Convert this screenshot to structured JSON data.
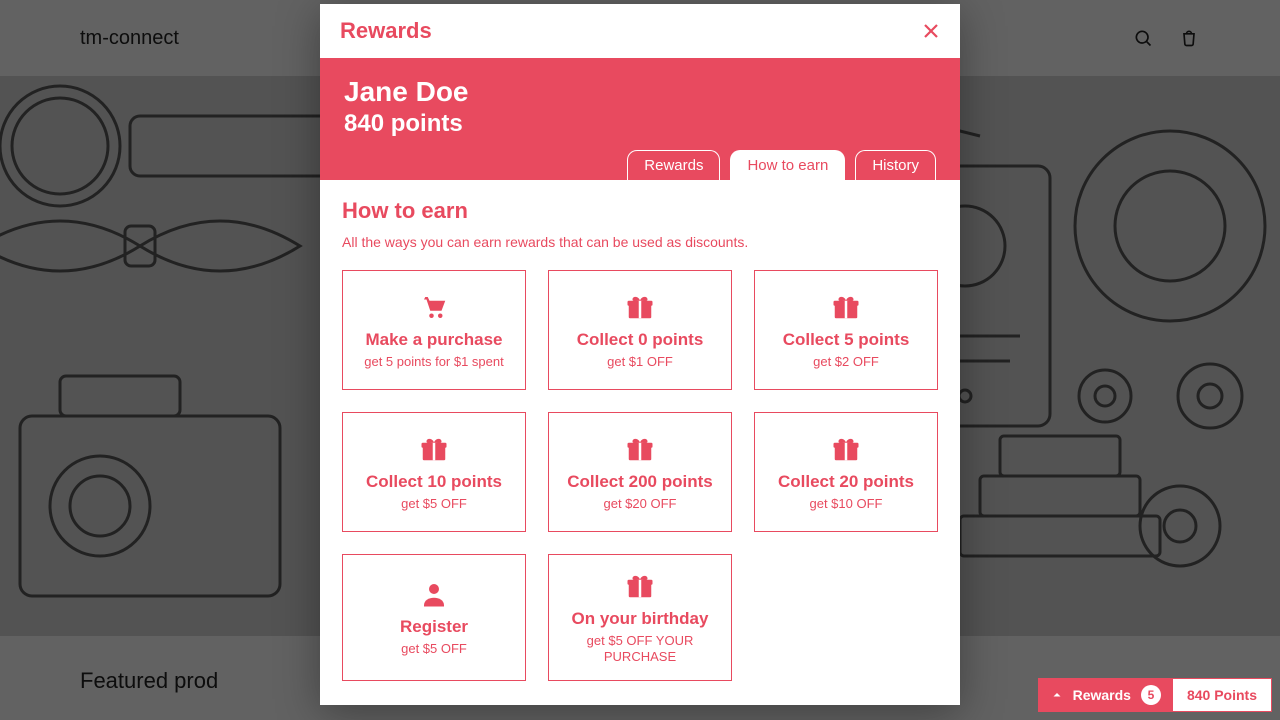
{
  "site": {
    "brand": "tm-connect",
    "featured_heading": "Featured prod"
  },
  "modal": {
    "title": "Rewards",
    "user_name": "Jane Doe",
    "points_line": "840 points",
    "tabs": {
      "rewards": "Rewards",
      "how": "How to earn",
      "history": "History"
    },
    "section_title": "How to earn",
    "section_sub": "All the ways you can earn rewards that can be used as discounts.",
    "cards": [
      {
        "icon": "cart",
        "title": "Make a purchase",
        "sub": "get 5 points for $1 spent"
      },
      {
        "icon": "gift",
        "title": "Collect 0 points",
        "sub": "get $1 OFF"
      },
      {
        "icon": "gift",
        "title": "Collect 5 points",
        "sub": "get $2 OFF"
      },
      {
        "icon": "gift",
        "title": "Collect 10 points",
        "sub": "get $5 OFF"
      },
      {
        "icon": "gift",
        "title": "Collect 200 points",
        "sub": "get $20 OFF"
      },
      {
        "icon": "gift",
        "title": "Collect 20 points",
        "sub": "get $10 OFF"
      },
      {
        "icon": "account",
        "title": "Register",
        "sub": "get $5 OFF"
      },
      {
        "icon": "gift",
        "title": "On your birthday",
        "sub": "get $5 OFF YOUR PURCHASE"
      }
    ]
  },
  "launcher": {
    "label": "Rewards",
    "badge": "5",
    "points": "840 Points"
  }
}
